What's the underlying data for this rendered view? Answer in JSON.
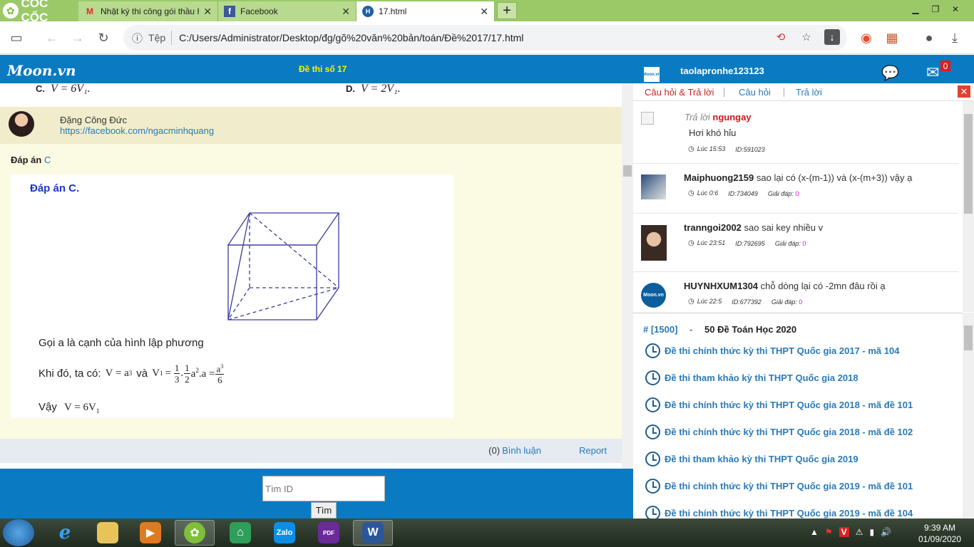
{
  "browser": {
    "brand": "CỐC CỐC",
    "tabs": [
      {
        "title": "Nhật ký thi công gói thầu Hồ",
        "icon": "gmail-icon"
      },
      {
        "title": "Facebook",
        "icon": "facebook-icon"
      },
      {
        "title": "17.html",
        "icon": "html-file-icon"
      }
    ],
    "address_label": "Tệp",
    "url": "C:/Users/Administrator/Desktop/đg/gõ%20văn%20bản/toán/Đề%2017/17.html"
  },
  "page": {
    "brand": "Moon.vn",
    "exam_title": "Đề thi số 17",
    "options": [
      {
        "letter": "C.",
        "text": "V = 6V₁."
      },
      {
        "letter": "D.",
        "text": "V = 2V₁."
      }
    ],
    "author": {
      "name": "Đặng Công Đức",
      "link": "https://facebook.com/ngacminhquang"
    },
    "answer_label": "Đáp án",
    "answer_value": "C",
    "solution": {
      "title": "Đáp án C.",
      "line1": "Gọi a là cạnh của hình lập phương",
      "line2_prefix": "Khi đó, ta có:",
      "line2_v": "V = a",
      "line2_and": "và",
      "line2_v1": "V",
      "line3_prefix": "Vậy",
      "line3_expr": "V = 6V"
    },
    "comments_count": "(0)",
    "comments_label": "Bình luận",
    "report_label": "Report",
    "search_placeholder": "Tìm ID",
    "search_button": "Tìm"
  },
  "panel": {
    "username": "taolapronhe123123",
    "mail_badge": "0",
    "tabs": [
      "Câu hỏi & Trả lời",
      "Câu hỏi",
      "Trả lời"
    ],
    "qa": [
      {
        "reply_label": "Trả lời",
        "user": "ngungay",
        "text": "Hơi khó hỉu",
        "time": "Lúc 15:53",
        "id": "ID:591023"
      },
      {
        "user": "Maiphuong2159",
        "text": "sao lại có (x-(m-1)) và (x-(m+3)) vậy ạ",
        "time": "Lúc 0:6",
        "id": "ID:734049",
        "answers_label": "Giải đáp:",
        "answers": "0"
      },
      {
        "user": "tranngoi2002",
        "text": "sao sai key nhiều v",
        "time": "Lúc 23:51",
        "id": "ID:792695",
        "answers_label": "Giải đáp:",
        "answers": "0"
      },
      {
        "user": "HUYNHXUM1304",
        "text": "chỗ dòng lại có -2mn đâu rồi ạ",
        "time": "Lúc 22:5",
        "id": "ID:677392",
        "answers_label": "Giải đáp:",
        "answers": "0"
      }
    ],
    "exam_group_id": "# [1500]",
    "exam_group_dash": "-",
    "exam_group_title": "50 Đề Toán Học 2020",
    "exams": [
      "Đề thi chính thức kỳ thi THPT Quốc gia 2017 - mã 104",
      "Đề thi tham khảo kỳ thi THPT Quốc gia 2018",
      "Đề thi chính thức kỳ thi THPT Quốc gia 2018 - mã đề 101",
      "Đề thi chính thức kỳ thi THPT Quốc gia 2018 - mã đề 102",
      "Đề thi tham khảo kỳ thi THPT Quốc gia 2019",
      "Đề thi chính thức kỳ thi THPT Quốc gia 2019 - mã đề 101",
      "Đề thi chính thức kỳ thi THPT Quốc gia 2019 - mã đề 104"
    ]
  },
  "taskbar": {
    "apps": [
      "Zalo",
      "PDF",
      "W"
    ],
    "time": "9:39 AM",
    "date": "01/09/2020"
  },
  "colors": {
    "brand_blue": "#0a7bc2",
    "title_yellow": "#fff200",
    "link_blue": "#2a7ab8",
    "tab_green": "#9bc968"
  }
}
